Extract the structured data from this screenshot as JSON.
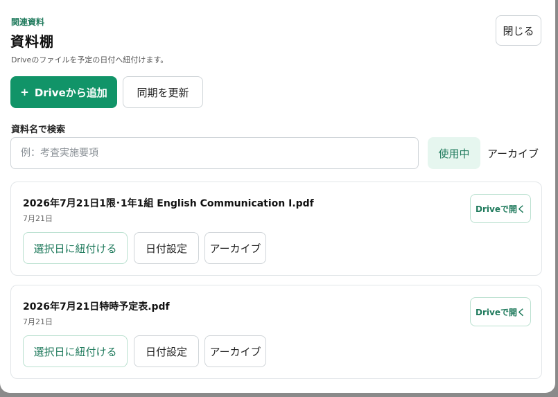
{
  "header": {
    "eyebrow": "関連資料",
    "title": "資料棚",
    "subtitle": "Driveのファイルを予定の日付へ紐付けます。",
    "close_label": "閉じる"
  },
  "toolbar": {
    "add_icon": "+",
    "add_label": "Driveから追加",
    "sync_label": "同期を更新"
  },
  "search": {
    "label": "資料名で検索",
    "value": "",
    "placeholder": "例：考査実施要項"
  },
  "filters": {
    "active_label": "使用中",
    "archive_label": "アーカイブ"
  },
  "files": [
    {
      "name": "2026年7月21日1限･1年1組 English Communication I.pdf",
      "date": "7月21日",
      "open_label": "Driveで開く",
      "link_label": "選択日に紐付ける",
      "date_label": "日付設定",
      "archive_label": "アーカイブ"
    },
    {
      "name": "2026年7月21日特時予定表.pdf",
      "date": "7月21日",
      "open_label": "Driveで開く",
      "link_label": "選択日に紐付ける",
      "date_label": "日付設定",
      "archive_label": "アーカイブ"
    }
  ],
  "colors": {
    "accent": "#119468",
    "accent_text": "#1f7a5c",
    "accent_soft": "#e6f6ef"
  }
}
